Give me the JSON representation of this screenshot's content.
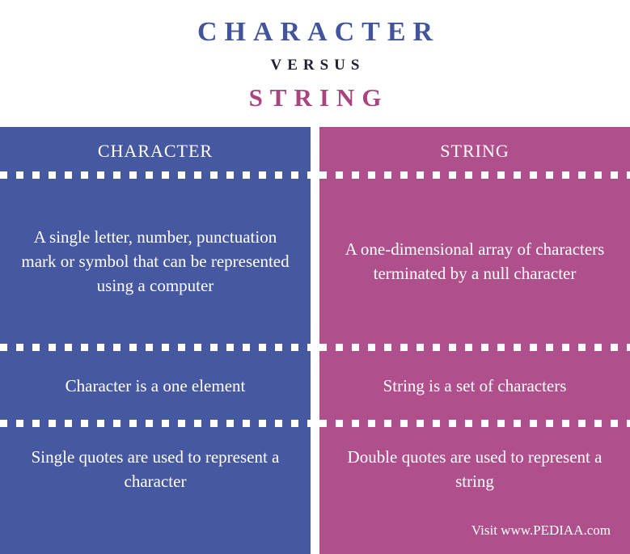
{
  "title": {
    "main": "CHARACTER",
    "versus": "VERSUS",
    "sub": "STRING"
  },
  "colors": {
    "character_blue": "#4558A0",
    "string_magenta": "#AF4F8C",
    "title_blue": "#42549B",
    "title_magenta": "#A9447E",
    "versus_dark": "#1d2033",
    "text_white": "#ffffff",
    "background": "#ffffff"
  },
  "columns": [
    {
      "header": "CHARACTER",
      "rows": [
        "A single letter, number, punctuation mark or symbol that can be represented using a computer",
        "Character is a one element",
        "Single quotes are used to represent a character"
      ],
      "footer": ""
    },
    {
      "header": "STRING",
      "rows": [
        "A one-dimensional array of characters terminated by a null character",
        "String is a set of characters",
        "Double quotes are used to represent a string"
      ],
      "footer": "Visit www.PEDIAA.com"
    }
  ]
}
